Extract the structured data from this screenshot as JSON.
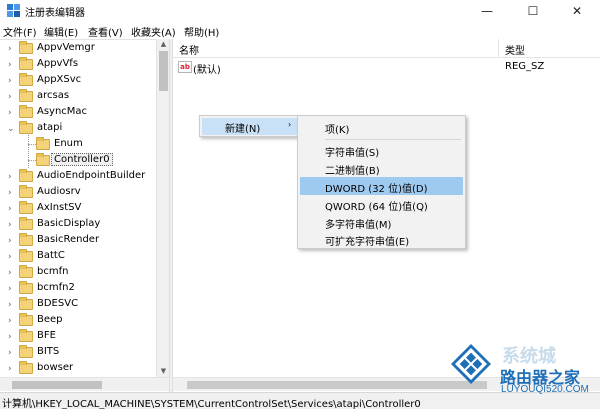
{
  "window": {
    "title": "注册表编辑器",
    "minimize_glyph": "—",
    "maximize_glyph": "☐",
    "close_glyph": "✕"
  },
  "menubar": {
    "items": [
      "文件(F)",
      "编辑(E)",
      "查看(V)",
      "收藏夹(A)",
      "帮助(H)"
    ]
  },
  "tree": {
    "items": [
      {
        "label": "AppvVemgr",
        "expander": "›"
      },
      {
        "label": "AppvVfs",
        "expander": "›"
      },
      {
        "label": "AppXSvc",
        "expander": "›"
      },
      {
        "label": "arcsas",
        "expander": "›"
      },
      {
        "label": "AsyncMac",
        "expander": "›"
      },
      {
        "label": "atapi",
        "expander": "⌄"
      },
      {
        "label": "Enum",
        "expander": ""
      },
      {
        "label": "Controller0",
        "expander": ""
      },
      {
        "label": "AudioEndpointBuilder",
        "expander": "›"
      },
      {
        "label": "Audiosrv",
        "expander": "›"
      },
      {
        "label": "AxInstSV",
        "expander": "›"
      },
      {
        "label": "BasicDisplay",
        "expander": "›"
      },
      {
        "label": "BasicRender",
        "expander": "›"
      },
      {
        "label": "BattC",
        "expander": "›"
      },
      {
        "label": "bcmfn",
        "expander": "›"
      },
      {
        "label": "bcmfn2",
        "expander": "›"
      },
      {
        "label": "BDESVC",
        "expander": "›"
      },
      {
        "label": "Beep",
        "expander": "›"
      },
      {
        "label": "BFE",
        "expander": "›"
      },
      {
        "label": "BITS",
        "expander": "›"
      },
      {
        "label": "bowser",
        "expander": "›"
      }
    ],
    "selected": "Controller0"
  },
  "list": {
    "columns": {
      "name": "名称",
      "type": "类型"
    },
    "rows": [
      {
        "icon": "ab",
        "name": "(默认)",
        "type": "REG_SZ"
      }
    ]
  },
  "context_menu": {
    "new_label": "新建(N)",
    "arrow": "›",
    "submenu": [
      {
        "label": "项(K)"
      },
      {
        "label": "字符串值(S)"
      },
      {
        "label": "二进制值(B)"
      },
      {
        "label": "DWORD (32 位)值(D)"
      },
      {
        "label": "QWORD (64 位)值(Q)"
      },
      {
        "label": "多字符串值(M)"
      },
      {
        "label": "可扩充字符串值(E)"
      }
    ],
    "highlighted": "DWORD (32 位)值(D)"
  },
  "statusbar": {
    "path": "计算机\\HKEY_LOCAL_MACHINE\\SYSTEM\\CurrentControlSet\\Services\\atapi\\Controller0"
  },
  "watermark": {
    "site_cn": "路由器之家",
    "site_en": "LUYOUQI520.COM",
    "ghost_text": "系统城"
  },
  "colors": {
    "accent_logo": "#1e6fb7",
    "menu_highlight": "#9fcaf0",
    "new_item_bg": "#c9e1f6",
    "folder": "#f3d27a"
  }
}
